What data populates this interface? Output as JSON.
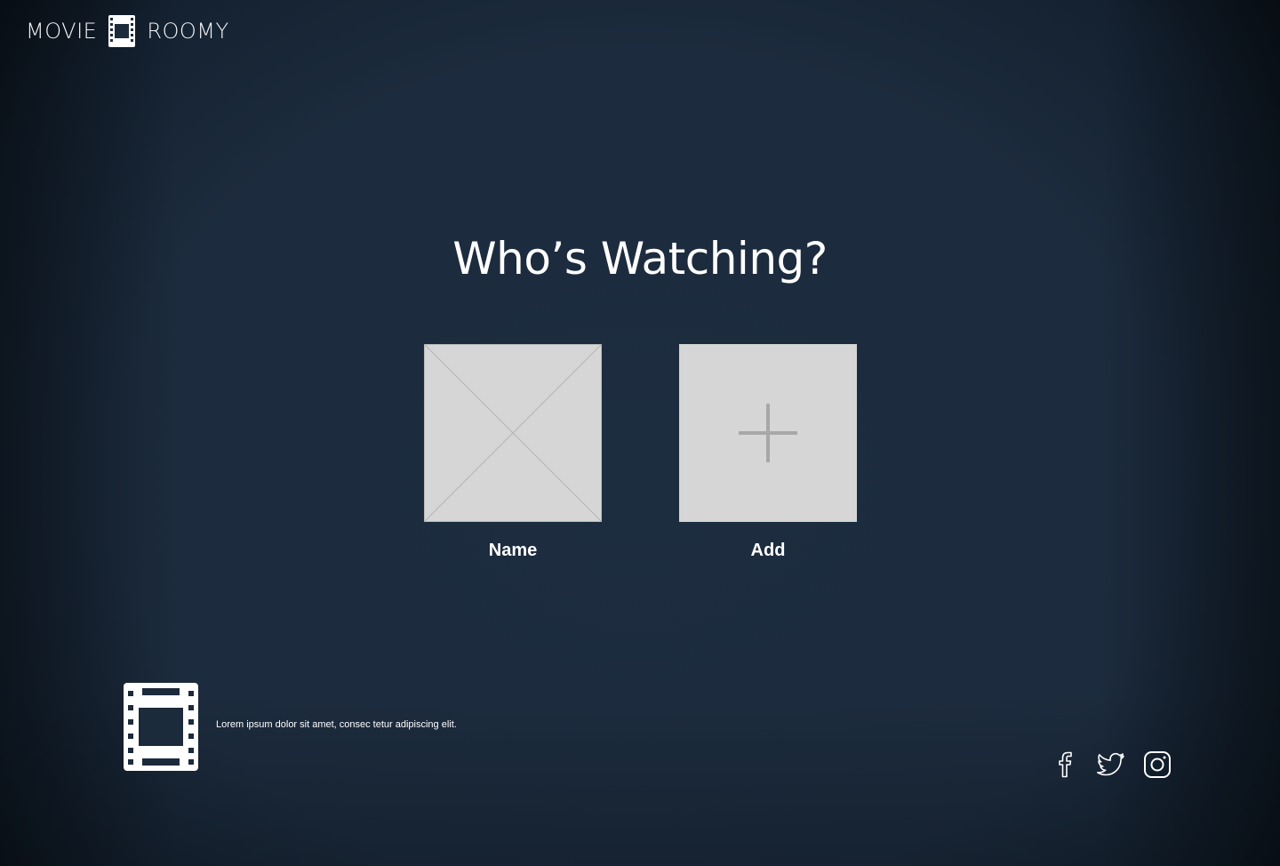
{
  "brand": {
    "left_word": "MOVIE",
    "right_word": "ROOMY",
    "logo_icon": "film-strip-icon"
  },
  "page": {
    "title": "Who’s Watching?"
  },
  "profiles": [
    {
      "name": "Name",
      "tile_icon": "placeholder-image-icon"
    },
    {
      "name": "Add",
      "tile_icon": "plus-icon"
    }
  ],
  "footer": {
    "logo_icon": "film-strip-icon",
    "text": "Lorem ipsum dolor sit amet, consec tetur adipiscing elit.",
    "social": [
      {
        "name": "facebook",
        "icon": "facebook-icon"
      },
      {
        "name": "twitter",
        "icon": "twitter-icon"
      },
      {
        "name": "instagram",
        "icon": "instagram-icon"
      }
    ]
  },
  "colors": {
    "background": "#1c2b3c",
    "tile": "#d6d6d6",
    "tile_line": "#b8b8b8",
    "plus": "#a8a8a8",
    "text": "#ffffff"
  }
}
